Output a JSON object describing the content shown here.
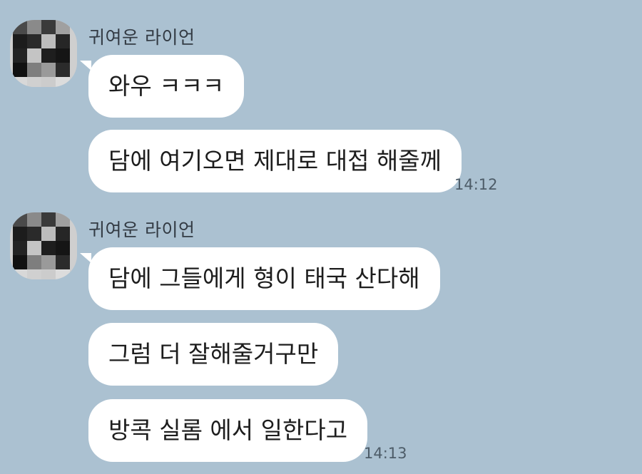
{
  "colors": {
    "background": "#abc1d1",
    "bubble": "#ffffff",
    "sender_text": "#333b44",
    "message_text": "#1d1d1d",
    "timestamp_text": "#4d5c68"
  },
  "groups": [
    {
      "sender": "귀여운 라이언",
      "avatar_icon": "pixelated-profile-avatar",
      "messages": [
        {
          "text": "와우 ㅋㅋㅋ",
          "time": ""
        },
        {
          "text": "담에 여기오면 제대로 대접 해줄께",
          "time": "14:12"
        }
      ]
    },
    {
      "sender": "귀여운 라이언",
      "avatar_icon": "pixelated-profile-avatar",
      "messages": [
        {
          "text": "담에 그들에게 형이 태국 산다해",
          "time": ""
        },
        {
          "text": "그럼 더 잘해줄거구만",
          "time": ""
        },
        {
          "text": "방콕 실롬 에서 일한다고",
          "time": "14:13"
        }
      ]
    }
  ]
}
